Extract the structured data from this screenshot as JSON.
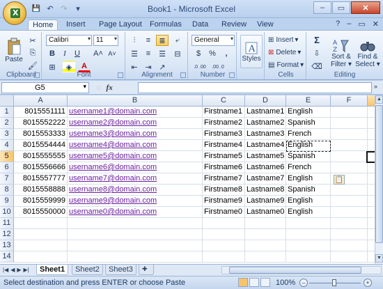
{
  "window": {
    "title": "Book1 - Microsoft Excel",
    "controls": {
      "minimize": "–",
      "maximize": "▭",
      "close": "✕"
    }
  },
  "quick_access": {
    "save": "💾",
    "undo": "↶",
    "redo": "↷",
    "customize": "▾"
  },
  "ribbon_tabs": [
    "Home",
    "Insert",
    "Page Layout",
    "Formulas",
    "Data",
    "Review",
    "View"
  ],
  "ribbon": {
    "clipboard": {
      "label": "Clipboard",
      "paste": "Paste"
    },
    "font": {
      "label": "Font",
      "family": "Calibri",
      "size": "11",
      "bold": "B",
      "italic": "I",
      "underline": "U",
      "grow": "A˄",
      "shrink": "A˅"
    },
    "alignment": {
      "label": "Alignment"
    },
    "number": {
      "label": "Number",
      "format": "General",
      "currency": "$",
      "percent": "%",
      "comma": ",",
      "inc_dec": ".0 .00",
      "dec_dec": ".00 .0"
    },
    "styles": {
      "label": "Styles"
    },
    "cells": {
      "label": "Cells",
      "insert": "Insert",
      "delete": "Delete",
      "format": "Format"
    },
    "editing": {
      "label": "Editing",
      "sum": "Σ",
      "sort": "Sort &",
      "sort2": "Filter",
      "find": "Find &",
      "find2": "Select"
    }
  },
  "formula_bar": {
    "name_box": "G5",
    "fx": "fx",
    "value": ""
  },
  "columns": [
    "A",
    "B",
    "C",
    "D",
    "E",
    "F"
  ],
  "rows": [
    {
      "n": "1",
      "a": "8015551111",
      "b": "username1@domain.com",
      "c": "Firstname1",
      "d": "Lastname1",
      "e": "English"
    },
    {
      "n": "2",
      "a": "8015552222",
      "b": "username2@domain.com",
      "c": "Firstname2",
      "d": "Lastname2",
      "e": "Spanish"
    },
    {
      "n": "3",
      "a": "8015553333",
      "b": "username3@domain.com",
      "c": "Firstname3",
      "d": "Lastname3",
      "e": "French"
    },
    {
      "n": "4",
      "a": "8015554444",
      "b": "username4@domain.com",
      "c": "Firstname4",
      "d": "Lastname4",
      "e": "English"
    },
    {
      "n": "5",
      "a": "8015555555",
      "b": "username5@domain.com",
      "c": "Firstname5",
      "d": "Lastname5",
      "e": "Spanish"
    },
    {
      "n": "6",
      "a": "8015556666",
      "b": "username6@domain.com",
      "c": "Firstname6",
      "d": "Lastname6",
      "e": "French"
    },
    {
      "n": "7",
      "a": "8015557777",
      "b": "username7@domain.com",
      "c": "Firstname7",
      "d": "Lastname7",
      "e": "English"
    },
    {
      "n": "8",
      "a": "8015558888",
      "b": "username8@domain.com",
      "c": "Firstname8",
      "d": "Lastname8",
      "e": "Spanish"
    },
    {
      "n": "9",
      "a": "8015559999",
      "b": "username9@domain.com",
      "c": "Firstname9",
      "d": "Lastname9",
      "e": "English"
    },
    {
      "n": "10",
      "a": "8015550000",
      "b": "username0@domain.com",
      "c": "Firstname0",
      "d": "Lastname0",
      "e": "English"
    },
    {
      "n": "11",
      "a": "",
      "b": "",
      "c": "",
      "d": "",
      "e": ""
    },
    {
      "n": "12",
      "a": "",
      "b": "",
      "c": "",
      "d": "",
      "e": ""
    },
    {
      "n": "13",
      "a": "",
      "b": "",
      "c": "",
      "d": "",
      "e": ""
    },
    {
      "n": "14",
      "a": "",
      "b": "",
      "c": "",
      "d": "",
      "e": ""
    }
  ],
  "sheets": [
    "Sheet1",
    "Sheet2",
    "Sheet3"
  ],
  "status": {
    "text": "Select destination and press ENTER or choose Paste",
    "zoom": "100%"
  },
  "colors": {
    "accent": "#f7c46a",
    "link": "#6a1e9e",
    "ribbon": "#dbe7f6"
  }
}
